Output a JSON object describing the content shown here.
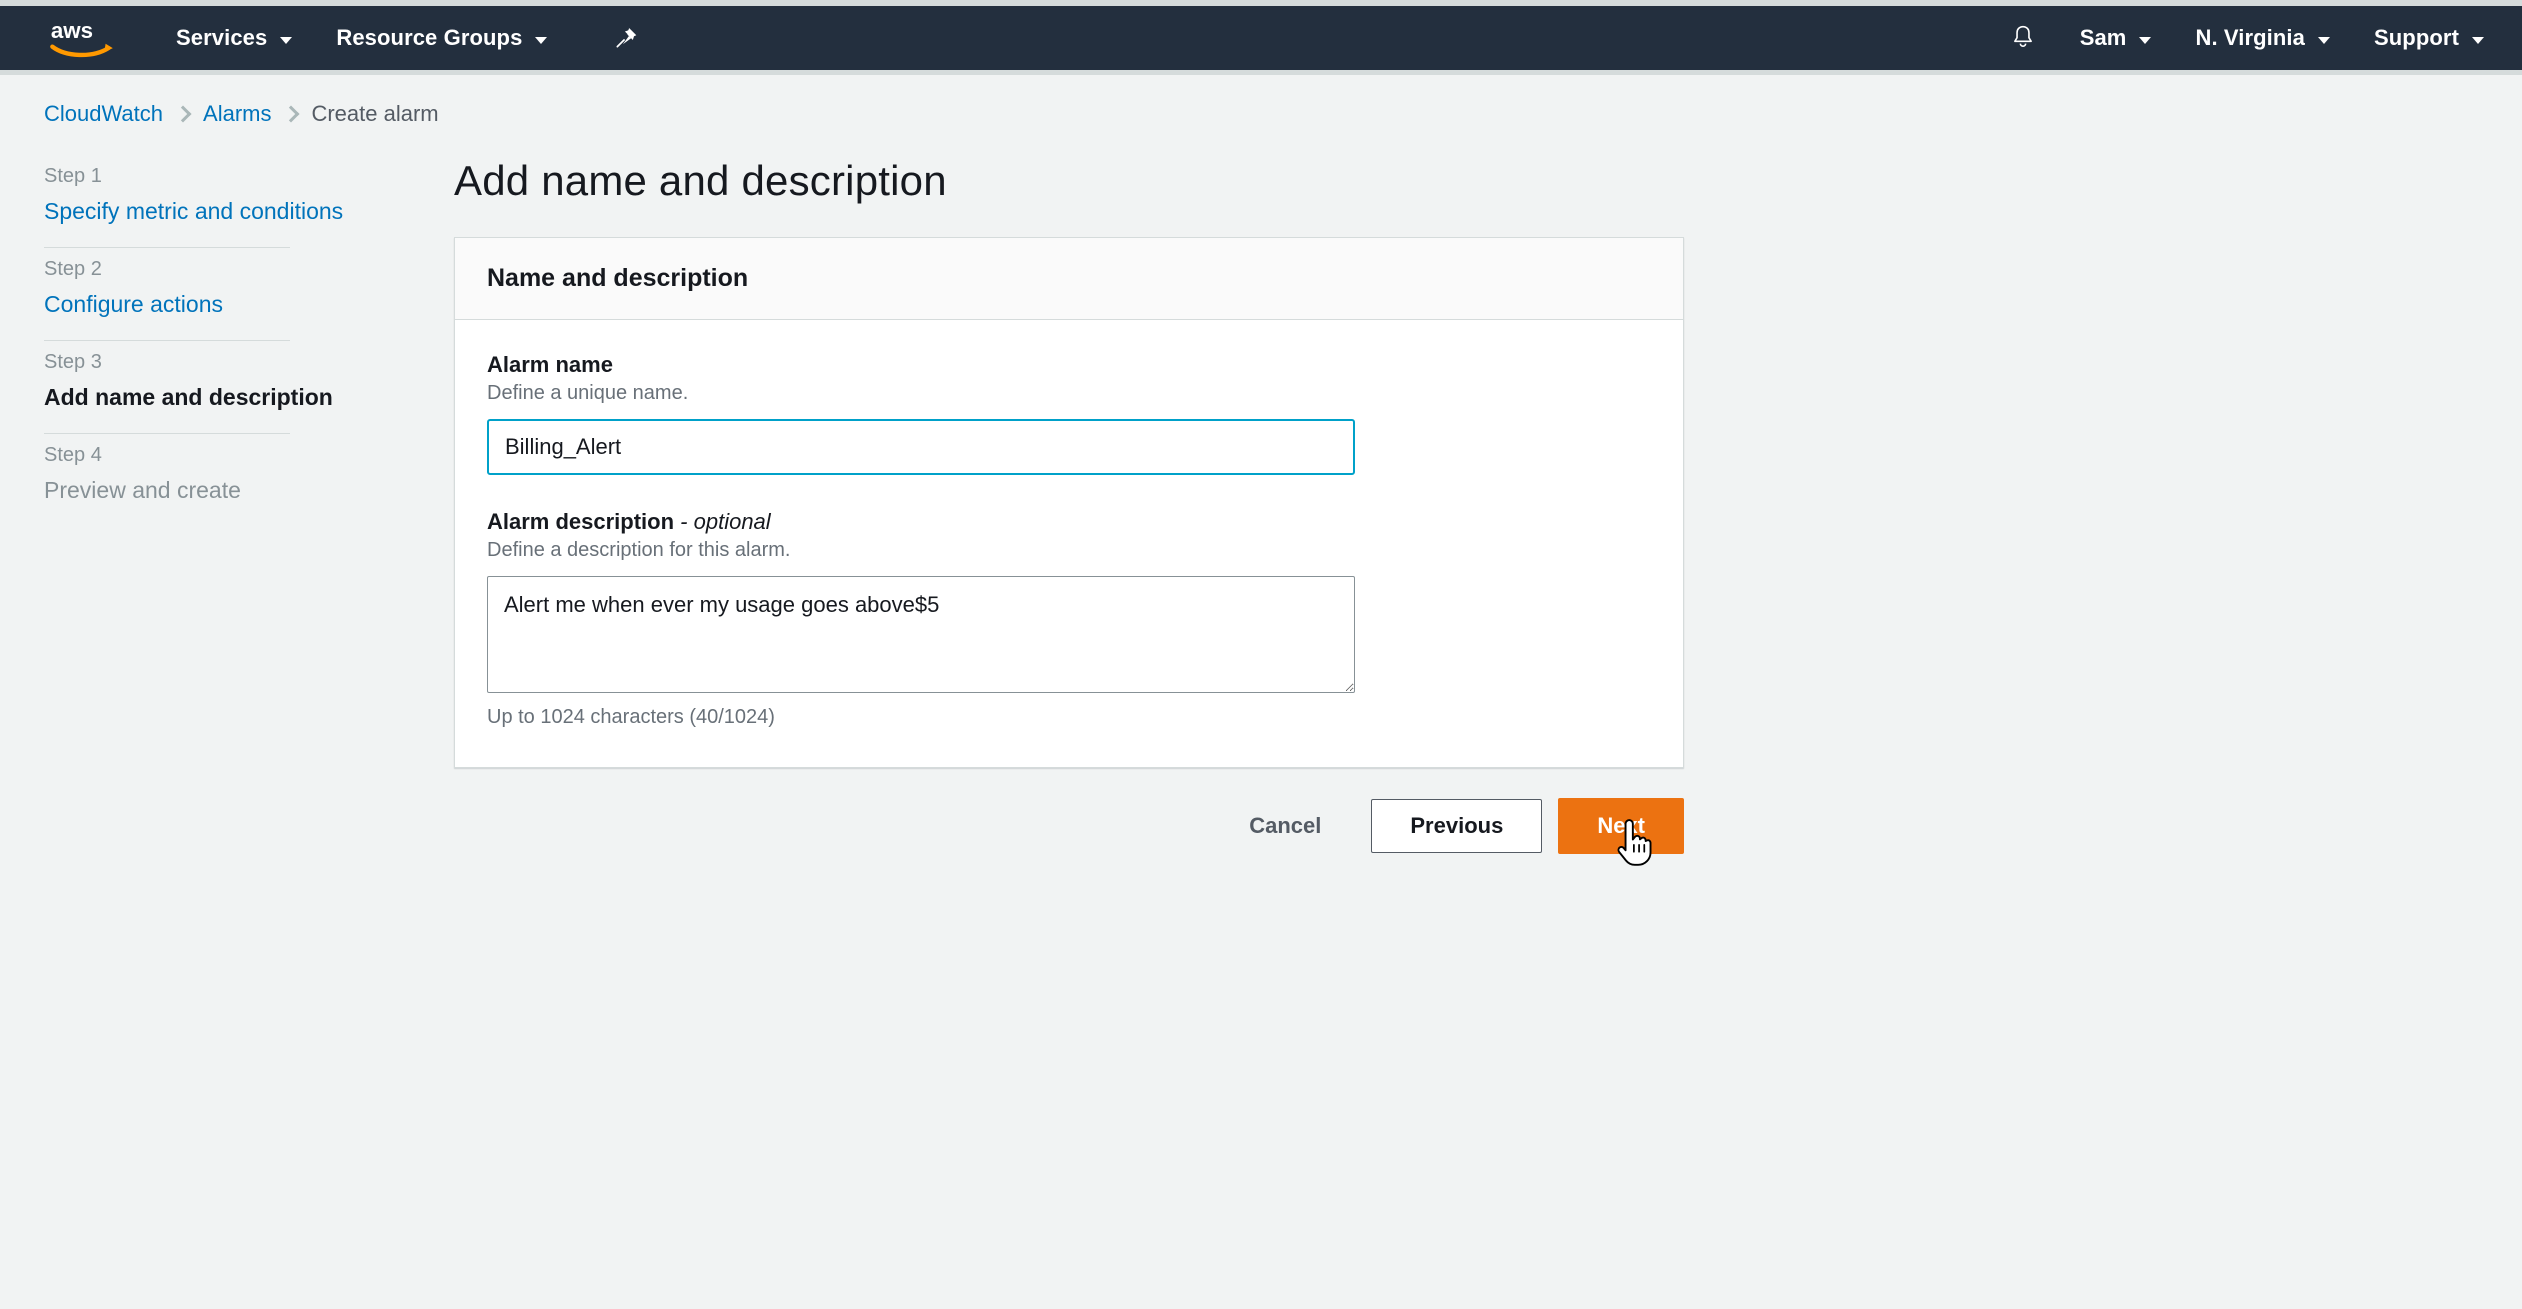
{
  "navbar": {
    "logo_alt": "aws-logo",
    "items": [
      {
        "label": "Services",
        "icon": "chevron-down-icon"
      },
      {
        "label": "Resource Groups",
        "icon": "chevron-down-icon"
      }
    ],
    "pin_icon": "pushpin-icon",
    "right": {
      "bell_icon": "bell-icon",
      "user": "Sam",
      "region": "N. Virginia",
      "support": "Support"
    }
  },
  "breadcrumb": {
    "items": [
      {
        "label": "CloudWatch",
        "link": true
      },
      {
        "label": "Alarms",
        "link": true
      },
      {
        "label": "Create alarm",
        "link": false
      }
    ]
  },
  "sidebar": {
    "steps": [
      {
        "num": "Step 1",
        "title": "Specify metric and conditions",
        "state": "link"
      },
      {
        "num": "Step 2",
        "title": "Configure actions",
        "state": "link"
      },
      {
        "num": "Step 3",
        "title": "Add name and description",
        "state": "active"
      },
      {
        "num": "Step 4",
        "title": "Preview and create",
        "state": "disabled"
      }
    ]
  },
  "main": {
    "page_title": "Add name and description",
    "card": {
      "header": "Name and description",
      "alarm_name": {
        "label": "Alarm name",
        "description": "Define a unique name.",
        "value": "Billing_Alert",
        "placeholder": ""
      },
      "alarm_description": {
        "label": "Alarm description",
        "label_optional": "- optional",
        "description": "Define a description for this alarm.",
        "value": "Alert me when ever my usage goes above$5",
        "placeholder": "",
        "char_count": "Up to 1024 characters (40/1024)"
      }
    },
    "actions": {
      "cancel": "Cancel",
      "previous": "Previous",
      "next": "Next"
    }
  },
  "colors": {
    "nav_background": "#232f3e",
    "page_background": "#f1f3f3",
    "link": "#0073bb",
    "primary_button": "#ec7211",
    "input_focus": "#00a1c9",
    "aws_orange": "#ff9900"
  },
  "cursor": {
    "type": "pointer-hand-cursor"
  }
}
